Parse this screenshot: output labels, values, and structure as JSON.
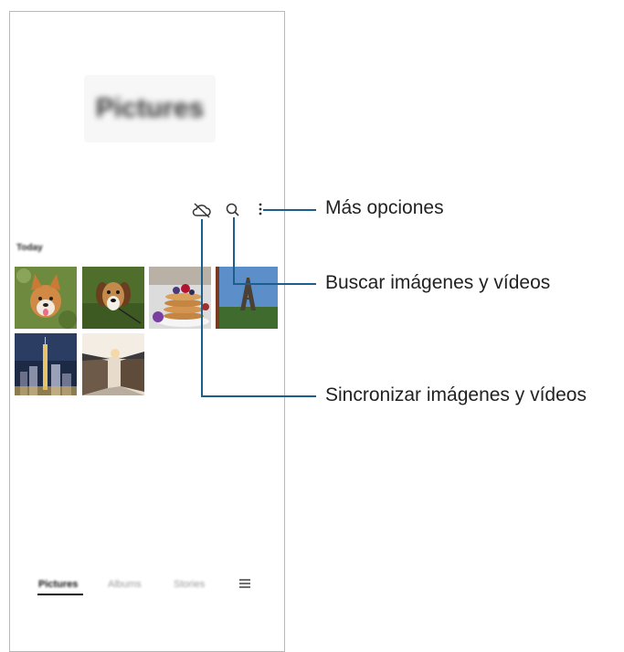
{
  "screen": {
    "title": "Pictures",
    "section_label": "Today",
    "tabs": [
      {
        "label": "Pictures",
        "active": true
      },
      {
        "label": "Albums",
        "active": false
      },
      {
        "label": "Stories",
        "active": false
      }
    ],
    "icons": [
      "cloud-off-icon",
      "search-icon",
      "more-options-icon",
      "menu-icon"
    ],
    "thumbnails": [
      "corgi-puppy",
      "beagle-dog",
      "pancakes-berries",
      "eiffel-tower",
      "city-night-skyline",
      "old-village-street"
    ]
  },
  "callouts": {
    "more_options": "Más opciones",
    "search": "Buscar imágenes y vídeos",
    "sync": "Sincronizar imágenes y vídeos"
  },
  "colors": {
    "leader_line": "#1d5f8c",
    "frame_border": "#b9b9b9"
  }
}
